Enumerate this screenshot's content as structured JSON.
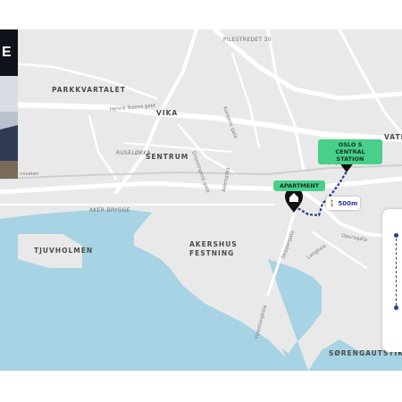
{
  "colors": {
    "land": "#e9e9e9",
    "water": "#a7d3e4",
    "road": "#ffffff",
    "route": "#2a3a8c",
    "poi_label_bg": "#48d08a",
    "marker": "#111111"
  },
  "photo_panel": {
    "heading_fragment": "E"
  },
  "districts": {
    "parkkvartalet": "PARKKVARTALET",
    "vika": "VIKA",
    "sentrum": "SENTRUM",
    "akershus": "AKERSHUS",
    "festning": "FESTNING",
    "tjuvholmen": "TJUVHOLMEN",
    "vater": "VATER",
    "sorengautstikkeren": "SØRENGAUTSTIKKER"
  },
  "streets": {
    "pilestredet": "PILESTREDET 30",
    "henrik_ibsens": "Henrik Ibsens gate",
    "ruseloekka": "RUSELØKKA",
    "aker_brygge": "AKER BRYGGE",
    "akersgata": "Akersgata",
    "skippergata": "Skippergata",
    "langkaia": "Langkaia",
    "vippetangen": "Vippetangkaia",
    "operagata": "Operagata",
    "bispegata": "Bispegata",
    "kongens": "Kongens gate",
    "dronningens": "Dronningens gate",
    "sjolystveien": "nsveien"
  },
  "pois": {
    "station": {
      "line1": "OSLO S",
      "line2": "CENTRAL STATION",
      "icon": "train-icon"
    },
    "apartment": {
      "label": "APARTMENT",
      "icon": "home-icon"
    }
  },
  "walk": {
    "distance": "500m",
    "icon": "walking-person-icon"
  }
}
